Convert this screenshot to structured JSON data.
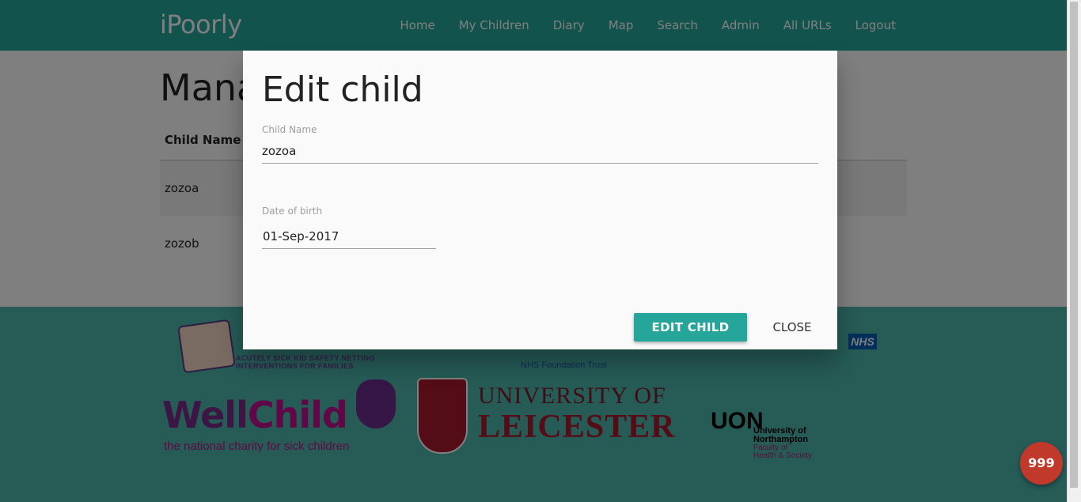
{
  "header": {
    "brand": "iPoorly",
    "nav": [
      "Home",
      "My Children",
      "Diary",
      "Map",
      "Search",
      "Admin",
      "All URLs",
      "Logout"
    ]
  },
  "page": {
    "heading_partial": "Mana",
    "table": {
      "header": "Child Name",
      "rows": [
        "zozoa",
        "zozob"
      ]
    }
  },
  "footer": {
    "ask_tagline_1": "ACUTELY SICK KID SAFETY NETTING",
    "ask_tagline_2": "INTERVENTIONS FOR FAMILIES",
    "nhs_trust": "NHS Foundation Trust",
    "nhs_badge": "NHS",
    "wellchild_a": "Well",
    "wellchild_b": "Child",
    "wellchild_tagline": "the national charity for sick children",
    "leicester_1": "UNIVERSITY OF",
    "leicester_2": "LEICESTER",
    "uon_mark": "UON",
    "uon_name_1": "University of",
    "uon_name_2": "Northampton",
    "uon_sub_1": "Faculty of",
    "uon_sub_2": "Health & Society"
  },
  "modal": {
    "title": "Edit child",
    "child_name_label": "Child Name",
    "child_name_value": "zozoa",
    "dob_label": "Date of birth",
    "dob_value": "01-Sep-2017",
    "edit_button": "EDIT CHILD",
    "close_button": "CLOSE"
  },
  "fab": {
    "label": "999"
  },
  "colors": {
    "primary": "#26a69a",
    "emergency": "#c0392b"
  }
}
